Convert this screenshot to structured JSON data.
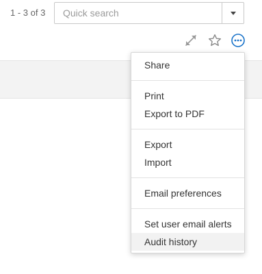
{
  "pager": {
    "count_text": "1 - 3 of 3"
  },
  "search": {
    "placeholder": "Quick search",
    "value": ""
  },
  "toolbar": {
    "icons": [
      "expand-icon",
      "star-icon",
      "more-options-icon"
    ],
    "accent_color": "#1a73c9"
  },
  "menu": {
    "groups": [
      {
        "items": [
          "Share"
        ]
      },
      {
        "items": [
          "Print",
          "Export to PDF"
        ]
      },
      {
        "items": [
          "Export",
          "Import"
        ]
      },
      {
        "items": [
          "Email preferences"
        ]
      },
      {
        "items": [
          "Set user email alerts",
          "Audit history"
        ]
      }
    ],
    "highlighted_item": "Audit history"
  }
}
